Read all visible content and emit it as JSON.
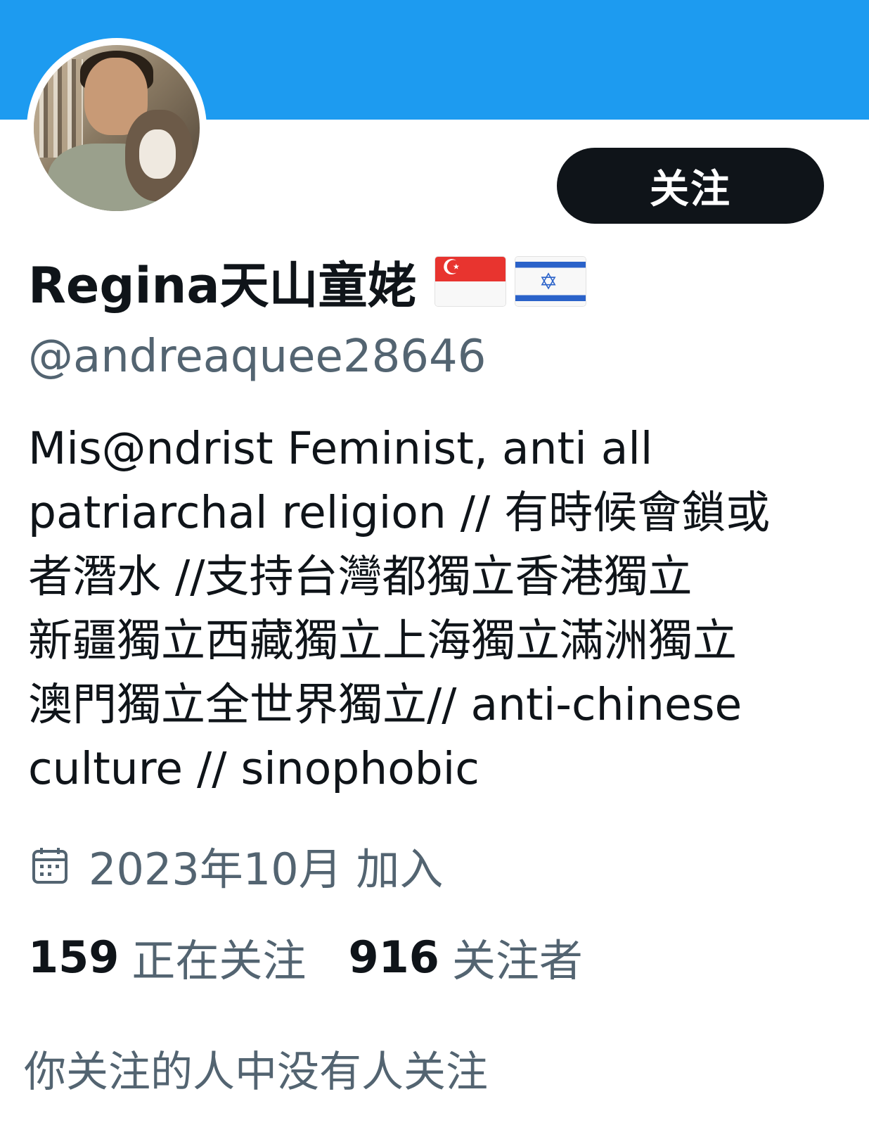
{
  "profile": {
    "display_name": "Regina天山童姥",
    "flags": [
      "singapore-flag",
      "israel-flag"
    ],
    "handle": "@andreaquee28646",
    "follow_label": "关注",
    "bio_lines": [
      "Mis@ndrist Feminist, anti all",
      "patriarchal religion // 有時候會鎖或",
      "者潛水 //支持台灣都獨立香港獨立",
      "新疆獨立西藏獨立上海獨立滿洲獨立",
      "澳門獨立全世界獨立// anti-chinese",
      "culture // sinophobic"
    ],
    "joined": "2023年10月 加入",
    "joined_icon": "calendar-icon",
    "following_count": "159",
    "following_label": "正在关注",
    "followers_count": "916",
    "followers_label": "关注者",
    "mutual_text": "你关注的人中没有人关注"
  },
  "colors": {
    "banner": "#1d9bf0",
    "button": "#0f1419",
    "secondary_text": "#536471",
    "primary_text": "#0f1419"
  }
}
